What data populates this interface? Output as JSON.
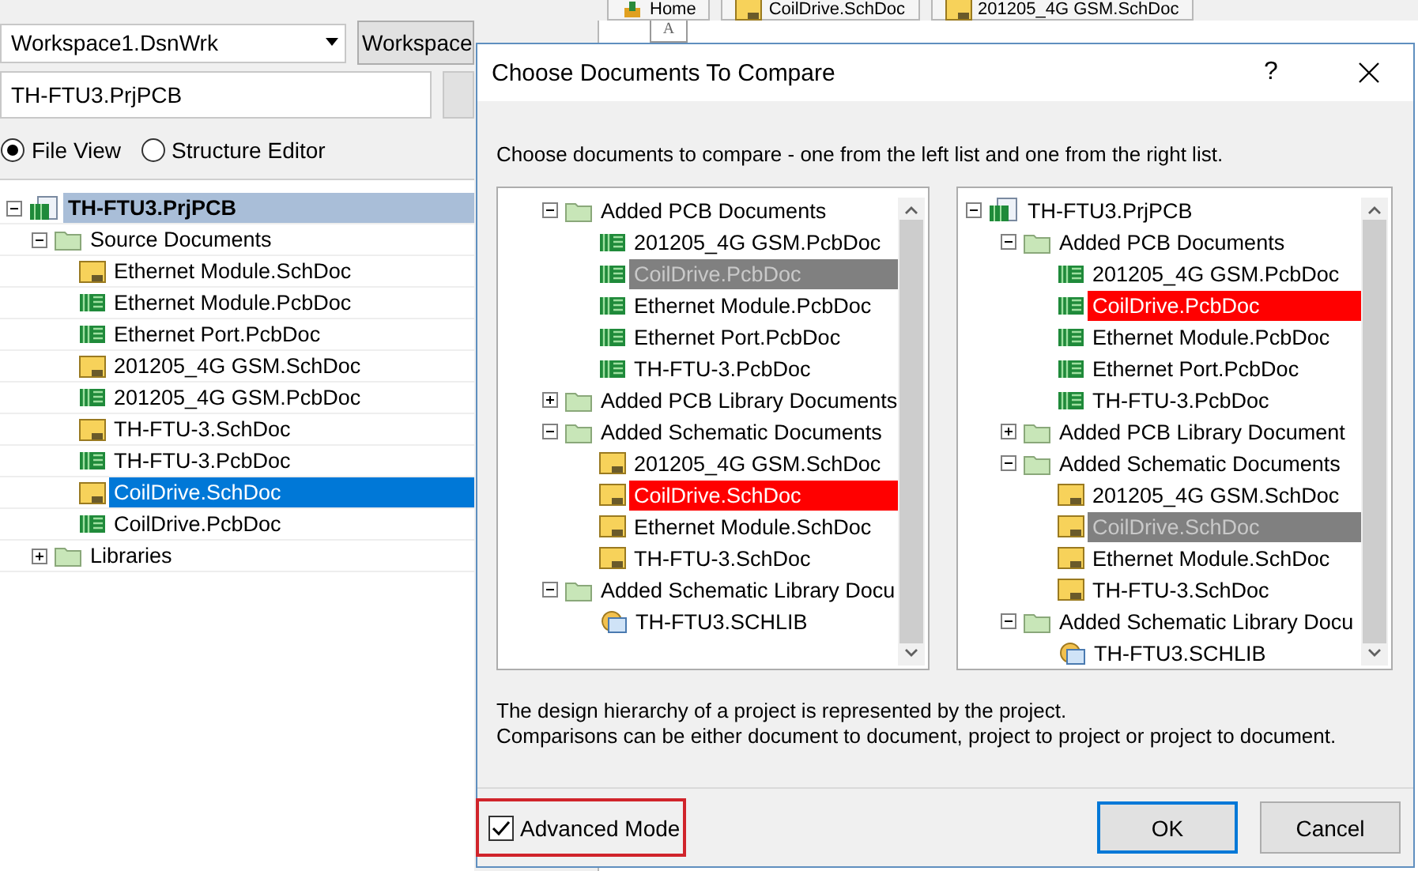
{
  "panel": {
    "workspace_combo": "Workspace1.DsnWrk",
    "workspace_button": "Workspace",
    "project_field": "TH-FTU3.PrjPCB",
    "view_options": [
      {
        "label": "File View",
        "selected": true
      },
      {
        "label": "Structure Editor",
        "selected": false
      }
    ],
    "project_tree": [
      {
        "label": "TH-FTU3.PrjPCB",
        "kind": "project",
        "expanded": true,
        "active": true,
        "selected": false,
        "children": [
          {
            "label": "Source Documents",
            "kind": "folder",
            "expanded": true,
            "selected": false,
            "children": [
              {
                "label": "Ethernet Module.SchDoc",
                "kind": "schdoc",
                "selected": false
              },
              {
                "label": "Ethernet Module.PcbDoc",
                "kind": "pcbdoc",
                "selected": false
              },
              {
                "label": "Ethernet Port.PcbDoc",
                "kind": "pcbdoc",
                "selected": false
              },
              {
                "label": "201205_4G GSM.SchDoc",
                "kind": "schdoc",
                "selected": false
              },
              {
                "label": "201205_4G GSM.PcbDoc",
                "kind": "pcbdoc",
                "selected": false
              },
              {
                "label": "TH-FTU-3.SchDoc",
                "kind": "schdoc",
                "selected": false
              },
              {
                "label": "TH-FTU-3.PcbDoc",
                "kind": "pcbdoc",
                "selected": false
              },
              {
                "label": "CoilDrive.SchDoc",
                "kind": "schdoc",
                "selected": true
              },
              {
                "label": "CoilDrive.PcbDoc",
                "kind": "pcbdoc",
                "selected": false
              }
            ]
          },
          {
            "label": "Libraries",
            "kind": "folder",
            "expanded": false,
            "selected": false
          }
        ]
      }
    ]
  },
  "document_tabs": [
    {
      "label": "Home",
      "kind": "home"
    },
    {
      "label": "CoilDrive.SchDoc",
      "kind": "schdoc"
    },
    {
      "label": "201205_4G GSM.SchDoc",
      "kind": "schdoc"
    }
  ],
  "sheet": {
    "column_header": "A"
  },
  "dialog": {
    "title": "Choose Documents To Compare",
    "help": "?",
    "instruction": "Choose documents to compare - one from the left list and one from the right list.",
    "left_list": [
      {
        "label": "Added PCB Documents",
        "kind": "folder",
        "expanded": true,
        "selected": false,
        "disabled": false,
        "children": [
          {
            "label": "201205_4G GSM.PcbDoc",
            "kind": "pcbdoc",
            "selected": false,
            "disabled": false
          },
          {
            "label": "CoilDrive.PcbDoc",
            "kind": "pcbdoc",
            "selected": false,
            "disabled": true
          },
          {
            "label": "Ethernet Module.PcbDoc",
            "kind": "pcbdoc",
            "selected": false,
            "disabled": false
          },
          {
            "label": "Ethernet Port.PcbDoc",
            "kind": "pcbdoc",
            "selected": false,
            "disabled": false
          },
          {
            "label": "TH-FTU-3.PcbDoc",
            "kind": "pcbdoc",
            "selected": false,
            "disabled": false
          }
        ]
      },
      {
        "label": "Added PCB Library Documents",
        "kind": "folder",
        "expanded": false,
        "selected": false,
        "disabled": false
      },
      {
        "label": "Added Schematic Documents",
        "kind": "folder",
        "expanded": true,
        "selected": false,
        "disabled": false,
        "children": [
          {
            "label": "201205_4G GSM.SchDoc",
            "kind": "schdoc",
            "selected": false,
            "disabled": false
          },
          {
            "label": "CoilDrive.SchDoc",
            "kind": "schdoc",
            "selected": true,
            "disabled": false
          },
          {
            "label": "Ethernet Module.SchDoc",
            "kind": "schdoc",
            "selected": false,
            "disabled": false
          },
          {
            "label": "TH-FTU-3.SchDoc",
            "kind": "schdoc",
            "selected": false,
            "disabled": false
          }
        ]
      },
      {
        "label": "Added Schematic Library Docu",
        "kind": "folder",
        "expanded": true,
        "selected": false,
        "disabled": false,
        "children": [
          {
            "label": "TH-FTU3.SCHLIB",
            "kind": "schlib",
            "selected": false,
            "disabled": false
          }
        ]
      }
    ],
    "right_list": [
      {
        "label": "TH-FTU3.PrjPCB",
        "kind": "project",
        "expanded": true,
        "selected": false,
        "disabled": false,
        "children": [
          {
            "label": "Added PCB Documents",
            "kind": "folder",
            "expanded": true,
            "selected": false,
            "disabled": false,
            "children": [
              {
                "label": "201205_4G GSM.PcbDoc",
                "kind": "pcbdoc",
                "selected": false,
                "disabled": false
              },
              {
                "label": "CoilDrive.PcbDoc",
                "kind": "pcbdoc",
                "selected": true,
                "disabled": false
              },
              {
                "label": "Ethernet Module.PcbDoc",
                "kind": "pcbdoc",
                "selected": false,
                "disabled": false
              },
              {
                "label": "Ethernet Port.PcbDoc",
                "kind": "pcbdoc",
                "selected": false,
                "disabled": false
              },
              {
                "label": "TH-FTU-3.PcbDoc",
                "kind": "pcbdoc",
                "selected": false,
                "disabled": false
              }
            ]
          },
          {
            "label": "Added PCB Library Document",
            "kind": "folder",
            "expanded": false,
            "selected": false,
            "disabled": false
          },
          {
            "label": "Added Schematic Documents",
            "kind": "folder",
            "expanded": true,
            "selected": false,
            "disabled": false,
            "children": [
              {
                "label": "201205_4G GSM.SchDoc",
                "kind": "schdoc",
                "selected": false,
                "disabled": false
              },
              {
                "label": "CoilDrive.SchDoc",
                "kind": "schdoc",
                "selected": false,
                "disabled": true
              },
              {
                "label": "Ethernet Module.SchDoc",
                "kind": "schdoc",
                "selected": false,
                "disabled": false
              },
              {
                "label": "TH-FTU-3.SchDoc",
                "kind": "schdoc",
                "selected": false,
                "disabled": false
              }
            ]
          },
          {
            "label": "Added Schematic Library Docu",
            "kind": "folder",
            "expanded": true,
            "selected": false,
            "disabled": false,
            "children": [
              {
                "label": "TH-FTU3.SCHLIB",
                "kind": "schlib",
                "selected": false,
                "disabled": false
              }
            ]
          }
        ]
      }
    ],
    "notes": [
      "The design hierarchy of a project is represented by the project.",
      "Comparisons can be either document to document, project to project or project to document."
    ],
    "advanced_mode": {
      "label": "Advanced Mode",
      "checked": true
    },
    "buttons": [
      {
        "label": "OK",
        "default": true
      },
      {
        "label": "Cancel",
        "default": false
      }
    ]
  }
}
